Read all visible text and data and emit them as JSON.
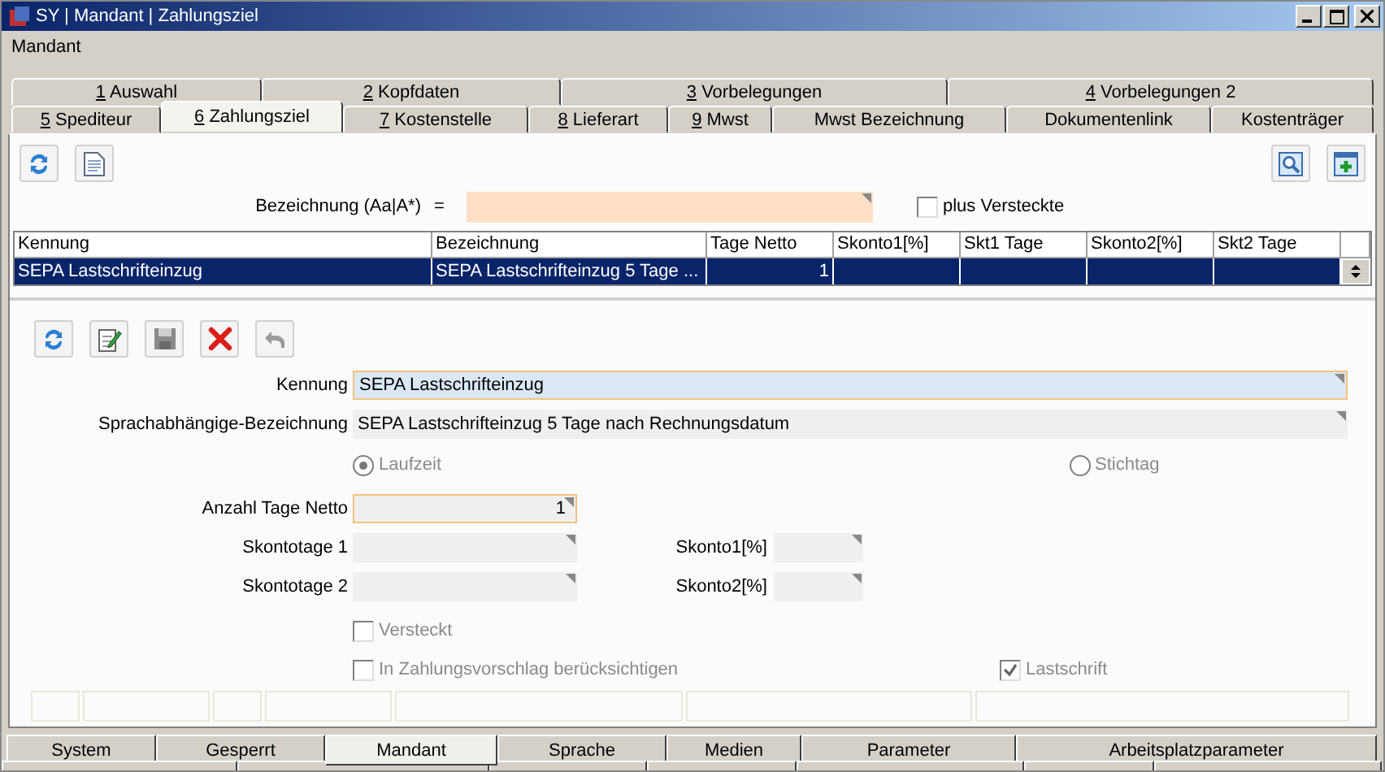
{
  "window": {
    "title": "SY | Mandant | Zahlungsziel"
  },
  "menu": [
    "Mandant"
  ],
  "tabs_row1": [
    {
      "mnemonic": "1",
      "label": "Auswahl",
      "selected": false
    },
    {
      "mnemonic": "2",
      "label": "Kopfdaten",
      "selected": false
    },
    {
      "mnemonic": "3",
      "label": "Vorbelegungen",
      "selected": false
    },
    {
      "mnemonic": "4",
      "label": "Vorbelegungen 2",
      "selected": false
    }
  ],
  "tabs_row2": [
    {
      "mnemonic": "5",
      "label": "Spediteur",
      "selected": false
    },
    {
      "mnemonic": "6",
      "label": "Zahlungsziel",
      "selected": true
    },
    {
      "mnemonic": "7",
      "label": "Kostenstelle",
      "selected": false
    },
    {
      "mnemonic": "8",
      "label": "Lieferart",
      "selected": false
    },
    {
      "mnemonic": "9",
      "label": "Mwst",
      "selected": false
    },
    {
      "label": "Mwst Bezeichnung",
      "selected": false
    },
    {
      "label": "Dokumentenlink",
      "selected": false
    },
    {
      "label": "Kostenträger",
      "selected": false
    }
  ],
  "filter": {
    "label": "Bezeichnung (Aa|A*)",
    "operator": "=",
    "checkbox": {
      "label": "plus Versteckte",
      "checked": false
    }
  },
  "table": {
    "columns": [
      "Kennung",
      "Bezeichnung",
      "Tage Netto",
      "Skonto1[%]",
      "Skt1 Tage",
      "Skonto2[%]",
      "Skt2 Tage"
    ],
    "rows": [
      {
        "selected": true,
        "cells": [
          "SEPA Lastschrifteinzug",
          "SEPA Lastschrifteinzug 5 Tage ...",
          "1",
          "",
          "",
          "",
          ""
        ]
      }
    ]
  },
  "form": {
    "kennung": {
      "label": "Kennung",
      "value": "SEPA Lastschrifteinzug"
    },
    "bezeichnung": {
      "label": "Sprachabhängige-Bezeichnung",
      "value": "SEPA Lastschrifteinzug 5 Tage nach Rechnungsdatum"
    },
    "radios": [
      {
        "label": "Laufzeit",
        "selected": true
      },
      {
        "label": "Stichtag",
        "selected": false
      }
    ],
    "tage_netto": {
      "label": "Anzahl Tage Netto",
      "value": "1"
    },
    "skonto_rows": [
      {
        "days_label": "Skontotage 1",
        "percent_label": "Skonto1[%]"
      },
      {
        "days_label": "Skontotage 2",
        "percent_label": "Skonto2[%]"
      }
    ],
    "versteckt": {
      "label": "Versteckt",
      "checked": false
    },
    "zahlungsvorschlag": {
      "label": "In Zahlungsvorschlag berücksichtigen",
      "checked": false
    },
    "lastschrift": {
      "label": "Lastschrift",
      "checked": true
    }
  },
  "bottom_tabs": [
    {
      "label": "System",
      "selected": false
    },
    {
      "label": "Gesperrt",
      "selected": false
    },
    {
      "label": "Mandant",
      "selected": true
    },
    {
      "label": "Sprache",
      "selected": false
    },
    {
      "label": "Medien",
      "selected": false
    },
    {
      "label": "Parameter",
      "selected": false
    },
    {
      "label": "Arbeitsplatzparameter",
      "selected": false
    }
  ]
}
